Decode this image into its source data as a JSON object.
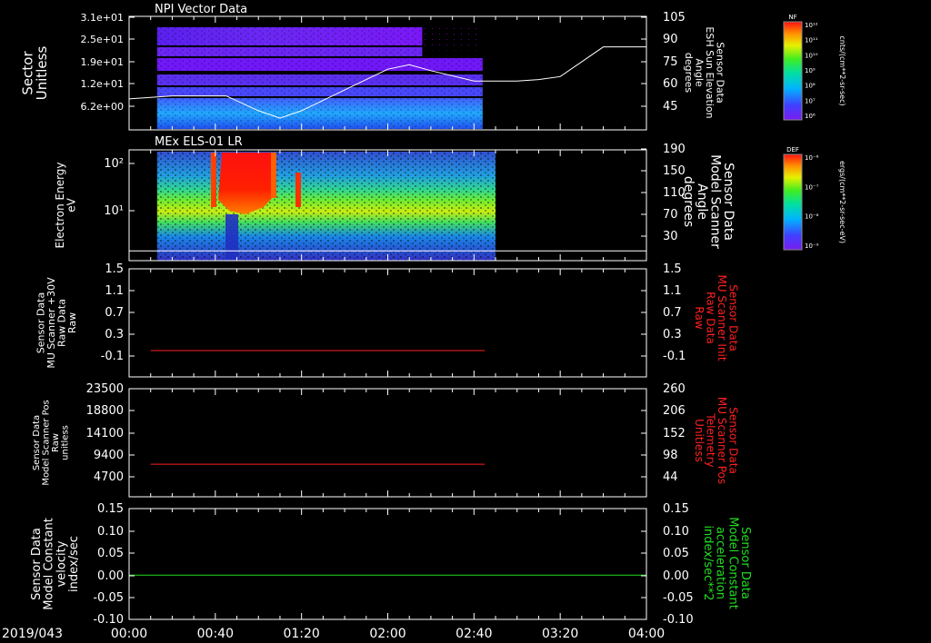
{
  "date_label": "2019/043",
  "time_ticks": [
    "00:00",
    "00:40",
    "01:20",
    "02:00",
    "02:40",
    "03:20",
    "04:00"
  ],
  "colors": {
    "background": "#000000",
    "frame": "#ffffff",
    "red": "#ff2020",
    "green": "#22dd22",
    "white": "#ffffff"
  },
  "chart_data": [
    {
      "type": "heatmap",
      "title": "NPI Vector Data",
      "ylabel_lines": [
        "Sector",
        "Unitless"
      ],
      "ytick_labels": [
        "3.1e+01",
        "2.5e+01",
        "1.9e+01",
        "1.2e+01",
        "6.2e+00"
      ],
      "ytick_values": [
        31,
        25,
        19,
        12,
        6.2
      ],
      "ylim": [
        0,
        31
      ],
      "overlay": {
        "type": "line",
        "ylabel_lines": [
          "Sensor Data",
          "ESH Sun Elevation",
          "Angle",
          "degrees"
        ],
        "ytick_labels": [
          "105",
          "90",
          "75",
          "60",
          "45"
        ],
        "ylim": [
          30,
          105
        ],
        "x": [
          "00:00",
          "00:20",
          "00:45",
          "01:00",
          "01:10",
          "01:20",
          "01:40",
          "02:00",
          "02:10",
          "02:20",
          "02:40",
          "03:00",
          "03:10",
          "03:20",
          "03:40",
          "04:00"
        ],
        "y": [
          50,
          52,
          52,
          42,
          37,
          42,
          56,
          70,
          73,
          69,
          62,
          62,
          63,
          65,
          85,
          85
        ]
      },
      "colorbar": {
        "label": "NF",
        "units": "cnts/(cm**2-sr-sec)",
        "tick_labels": [
          "10¹²",
          "10¹¹",
          "10¹⁰",
          "10⁹",
          "10⁸",
          "10⁷",
          "10⁶"
        ]
      }
    },
    {
      "type": "heatmap",
      "title": "MEx ELS-01 LR",
      "ylabel_lines": [
        "Electron Energy",
        "eV"
      ],
      "ytick_labels": [
        "10²",
        "10¹"
      ],
      "scale": "log",
      "overlay": {
        "type": "line",
        "ylabel_lines": [
          "Sensor Data",
          "Model Scanner",
          "Angle",
          "degrees"
        ],
        "ytick_labels": [
          "190",
          "150",
          "110",
          "70",
          "30"
        ],
        "ylim": [
          -10,
          190
        ],
        "x": [
          "00:00",
          "04:00"
        ],
        "y": [
          3,
          3
        ]
      },
      "colorbar": {
        "label": "DEF",
        "units": "ergs/(cm**2-sr-sec-eV)",
        "tick_labels": [
          "10⁻⁶",
          "10⁻⁷",
          "10⁻⁸",
          "10⁻⁹"
        ]
      }
    },
    {
      "type": "line",
      "ylabel_lines": [
        "Sensor Data",
        "MU Scanner +30V",
        "Raw Data",
        "Raw"
      ],
      "ytick_labels": [
        "1.5",
        "1.1",
        "0.7",
        "0.3",
        "-0.1"
      ],
      "ylim": [
        -0.3,
        1.5
      ],
      "right_ylabel_lines": [
        "Sensor Data",
        "MU Scanner Init",
        "Raw Data",
        "Raw"
      ],
      "right_ytick_labels": [
        "1.5",
        "1.1",
        "0.7",
        "0.3",
        "-0.1"
      ],
      "series": [
        {
          "color": "#ff2020",
          "x": [
            "00:10",
            "02:45"
          ],
          "y": [
            0.0,
            0.0
          ]
        }
      ]
    },
    {
      "type": "line",
      "ylabel_lines": [
        "Sensor Data",
        "Model Scanner Pos",
        "Raw",
        "unitless"
      ],
      "ytick_labels": [
        "23500",
        "18800",
        "14100",
        "9400",
        "4700"
      ],
      "ylim": [
        0,
        23500
      ],
      "right_ylabel_lines": [
        "Sensor Data",
        "MU Scanner Pos",
        "Telemetry",
        "Unitless"
      ],
      "right_ytick_labels": [
        "260",
        "206",
        "152",
        "98",
        "44"
      ],
      "series": [
        {
          "color": "#ff2020",
          "x": [
            "00:10",
            "02:45"
          ],
          "y": [
            7400,
            7400
          ]
        }
      ]
    },
    {
      "type": "line",
      "ylabel_lines": [
        "Sensor Data",
        "Model Constant",
        "velocity",
        "index/sec"
      ],
      "ytick_labels": [
        "0.15",
        "0.10",
        "0.05",
        "0.00",
        "-0.05",
        "-0.10"
      ],
      "ylim": [
        -0.1,
        0.15
      ],
      "right_ylabel_lines": [
        "Sensor Data",
        "Model Constant",
        "acceleration",
        "index/sec**2"
      ],
      "right_ytick_labels": [
        "0.15",
        "0.10",
        "0.05",
        "0.00",
        "-0.05",
        "-0.10"
      ],
      "series": [
        {
          "color": "#22dd22",
          "x": [
            "00:00",
            "04:00"
          ],
          "y": [
            0.0,
            0.0
          ]
        }
      ]
    }
  ]
}
